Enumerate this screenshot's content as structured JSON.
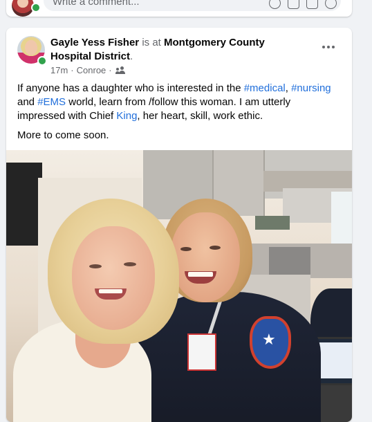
{
  "previous_post": {
    "comment_placeholder": "Write a comment..."
  },
  "post": {
    "author": "Gayle Yess Fisher",
    "is_at": "is at",
    "place": "Montgomery County Hospital District",
    "place_suffix": ".",
    "time": "17m",
    "separator": "·",
    "location": "Conroe",
    "audience_icon": "friends-icon",
    "body": {
      "p1_a": "If anyone has a daughter who is interested in the ",
      "tag_medical": "#medical",
      "p1_b": ", ",
      "tag_nursing": "#nursing",
      "p1_c": " and ",
      "tag_ems": "#EMS",
      "p1_d": " world, learn from /follow this woman. I am utterly impressed with Chief ",
      "tag_king": "King",
      "p1_e": ", her heart, skill, work ethic.",
      "p2": "More to come soon."
    }
  },
  "colors": {
    "link": "#216fdb",
    "online": "#31a24c",
    "secondary_text": "#65676b",
    "background": "#f0f2f5"
  }
}
